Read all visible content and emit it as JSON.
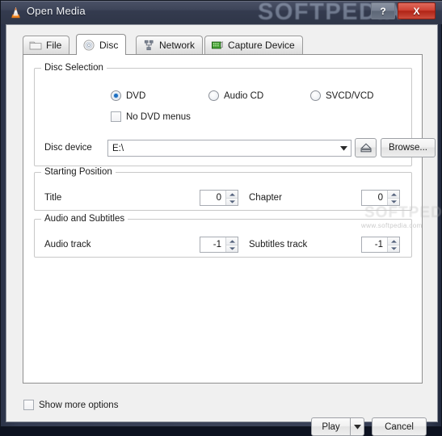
{
  "window": {
    "title": "Open Media",
    "app_icon": "vlc-cone-icon",
    "help_label": "?",
    "close_label": "X",
    "watermark_top": "SOFTPEDIA",
    "watermark_mid": "SOFTPEDIA",
    "watermark_url": "www.softpedia.com"
  },
  "tabs": [
    {
      "label": "File",
      "icon": "folder-icon",
      "active": false
    },
    {
      "label": "Disc",
      "icon": "disc-icon",
      "active": true
    },
    {
      "label": "Network",
      "icon": "network-icon",
      "active": false
    },
    {
      "label": "Capture Device",
      "icon": "capture-card-icon",
      "active": false
    }
  ],
  "disc_selection": {
    "group_title": "Disc Selection",
    "radios": [
      {
        "label": "DVD",
        "checked": true
      },
      {
        "label": "Audio CD",
        "checked": false
      },
      {
        "label": "SVCD/VCD",
        "checked": false
      }
    ],
    "no_dvd_menus": {
      "label": "No DVD menus",
      "checked": false
    },
    "device_label": "Disc device",
    "device_value": "E:\\",
    "eject_icon": "eject-icon",
    "browse_label": "Browse..."
  },
  "starting_position": {
    "group_title": "Starting Position",
    "title_label": "Title",
    "title_value": "0",
    "chapter_label": "Chapter",
    "chapter_value": "0"
  },
  "audio_subtitles": {
    "group_title": "Audio and Subtitles",
    "audio_label": "Audio track",
    "audio_value": "-1",
    "subtitles_label": "Subtitles track",
    "subtitles_value": "-1"
  },
  "footer": {
    "show_more_label": "Show more options",
    "show_more_checked": false,
    "play_label": "Play",
    "play_dropdown_icon": "chevron-down-icon",
    "cancel_label": "Cancel"
  },
  "colors": {
    "titlebar": "#3b4358",
    "close_button": "#cf4335",
    "radio_dot": "#1d6fc2",
    "panel_bg": "#ffffff",
    "dialog_bg": "#f0f0f0"
  }
}
